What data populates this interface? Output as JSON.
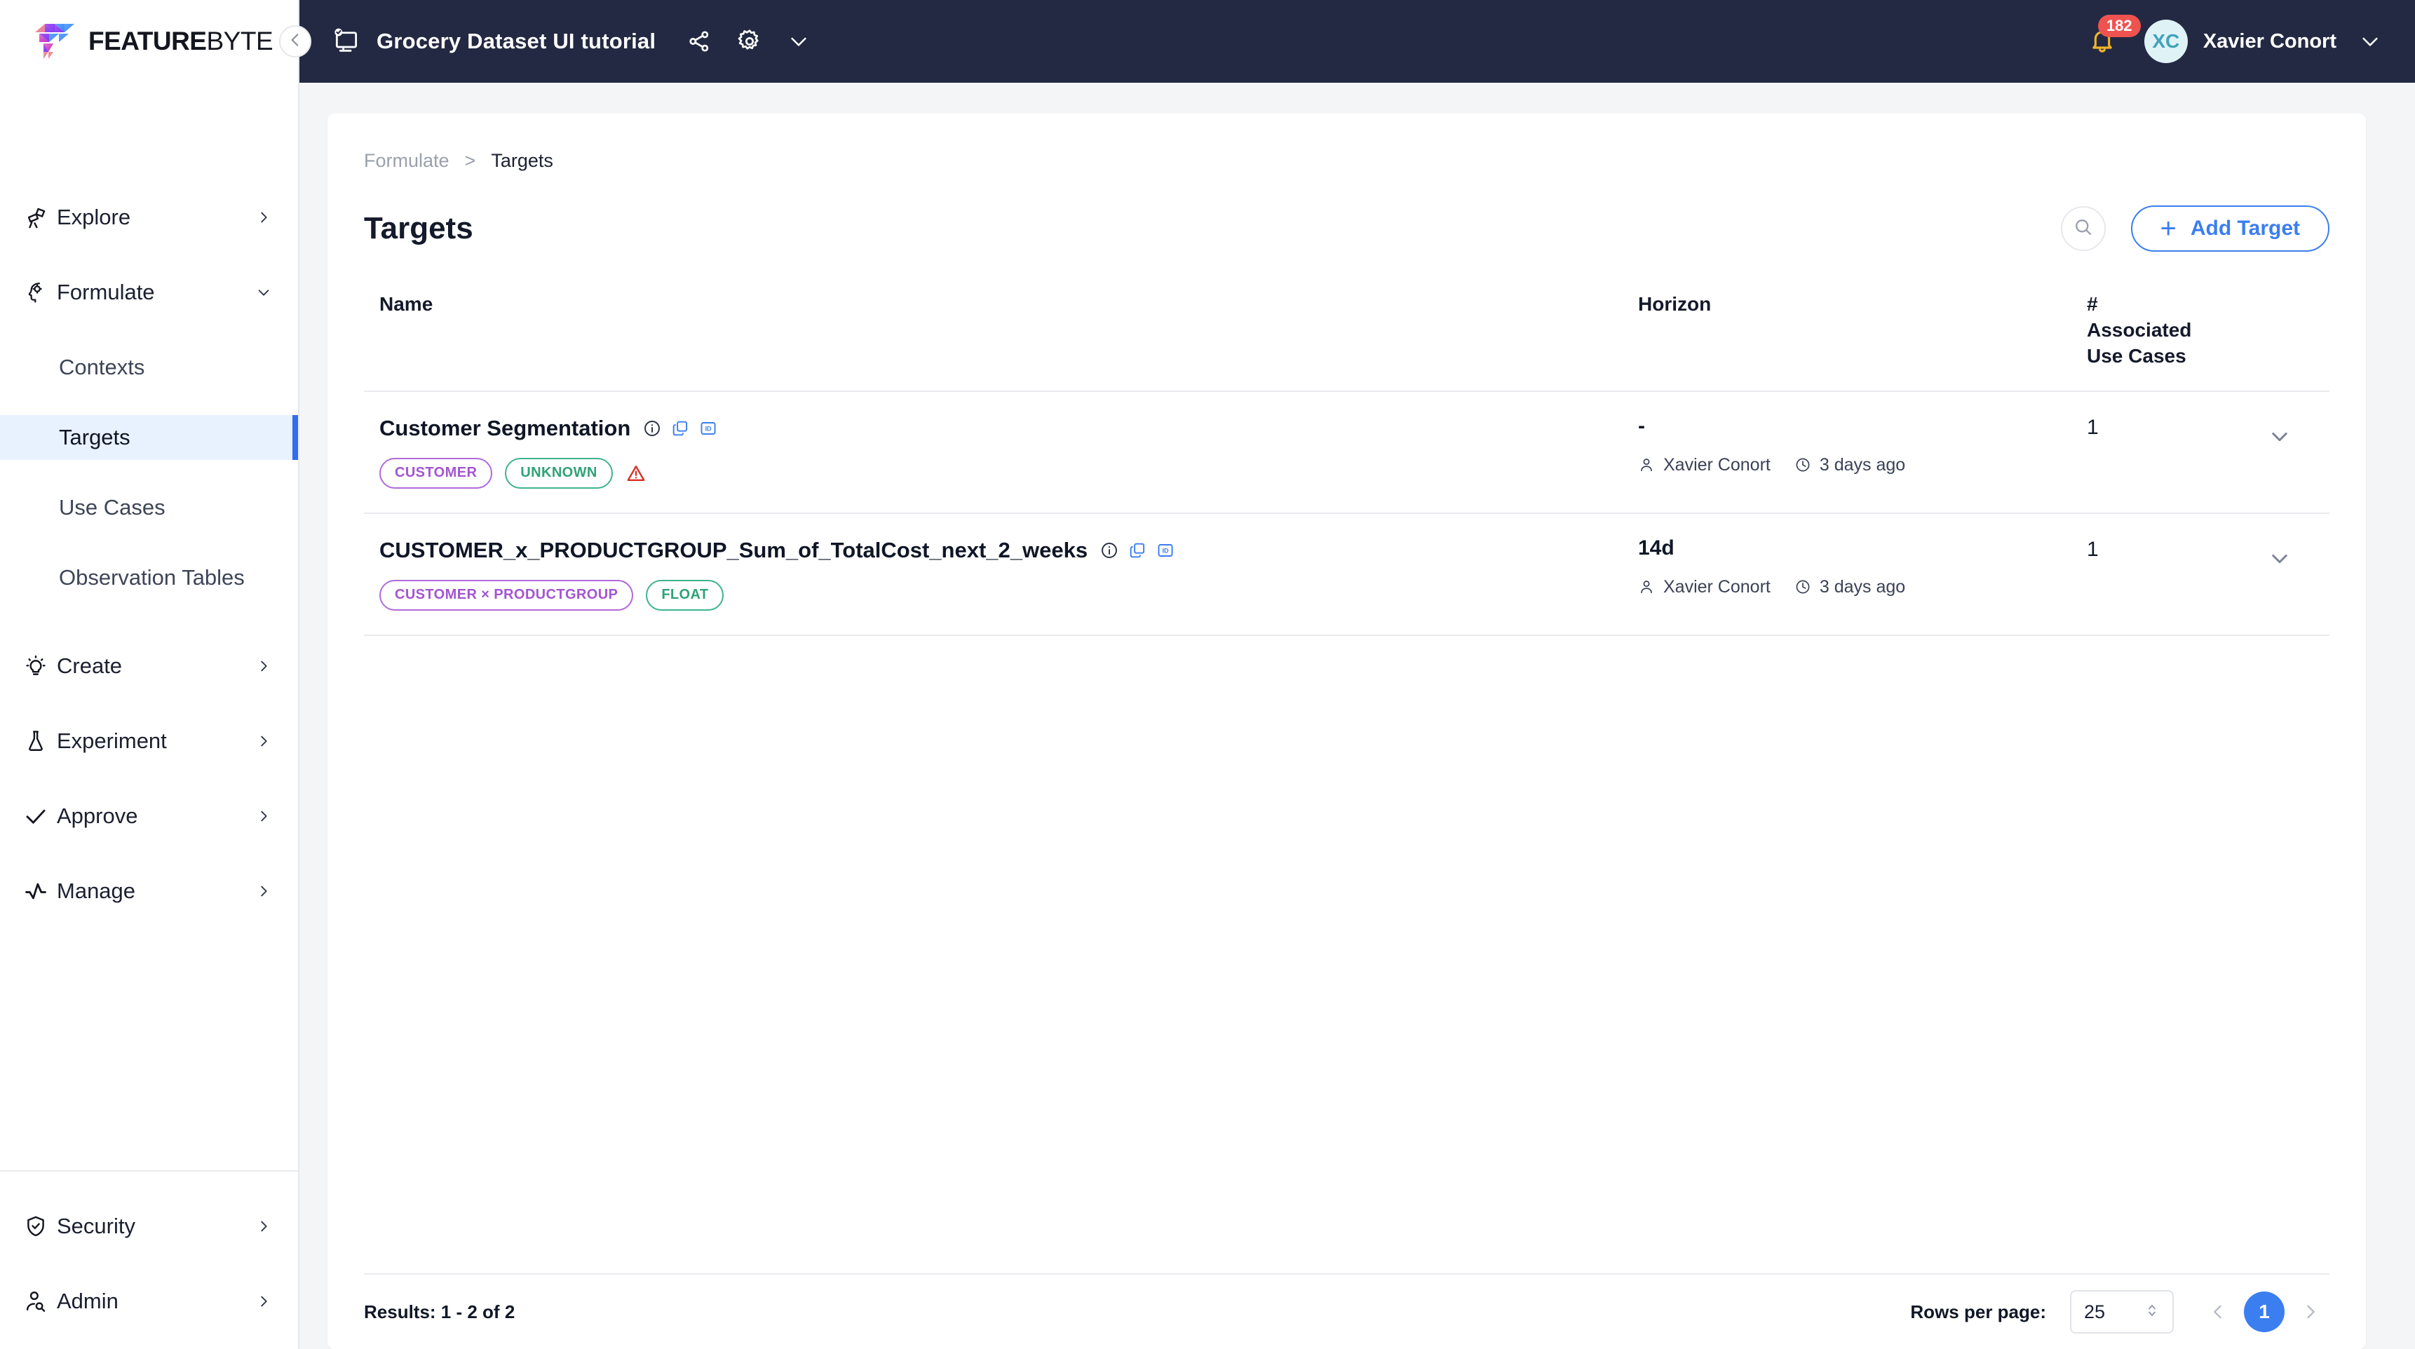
{
  "brand": {
    "name_bold": "FEATURE",
    "name_light": "BYTE"
  },
  "topbar": {
    "workspace_icon": "monitor-check-icon",
    "workspace_title": "Grocery Dataset UI tutorial",
    "share_icon": "share-icon",
    "settings_icon": "gear-icon",
    "more_icon": "chevron-down-icon",
    "notification_count": "182",
    "avatar_initials": "XC",
    "user_name": "Xavier Conort"
  },
  "sidebar": {
    "collapse_icon": "chevron-left-icon",
    "items": [
      {
        "label": "Explore",
        "icon": "telescope-icon",
        "chevron": "chevron-right-icon",
        "expanded": false
      },
      {
        "label": "Formulate",
        "icon": "head-gear-icon",
        "chevron": "chevron-down-icon",
        "expanded": true
      }
    ],
    "formulate_children": [
      {
        "label": "Contexts",
        "active": false
      },
      {
        "label": "Targets",
        "active": true
      },
      {
        "label": "Use Cases",
        "active": false
      },
      {
        "label": "Observation Tables",
        "active": false
      }
    ],
    "items_after": [
      {
        "label": "Create",
        "icon": "lightbulb-icon",
        "chevron": "chevron-right-icon"
      },
      {
        "label": "Experiment",
        "icon": "flask-icon",
        "chevron": "chevron-right-icon"
      },
      {
        "label": "Approve",
        "icon": "check-icon",
        "chevron": "chevron-right-icon"
      },
      {
        "label": "Manage",
        "icon": "activity-icon",
        "chevron": "chevron-right-icon"
      }
    ],
    "bottom_items": [
      {
        "label": "Security",
        "icon": "shield-check-icon",
        "chevron": "chevron-right-icon"
      },
      {
        "label": "Admin",
        "icon": "user-search-icon",
        "chevron": "chevron-right-icon"
      }
    ]
  },
  "breadcrumb": {
    "parent": "Formulate",
    "separator": ">",
    "current": "Targets"
  },
  "page": {
    "title": "Targets",
    "search_icon": "search-icon",
    "add_button_label": "Add Target",
    "add_button_plus": "+"
  },
  "table": {
    "headers": {
      "name": "Name",
      "horizon": "Horizon",
      "use_cases_line1": "#",
      "use_cases_line2": "Associated",
      "use_cases_line3": "Use Cases"
    },
    "rows": [
      {
        "name": "Customer Segmentation",
        "info_icon": "info-circle-icon",
        "copy_icon": "copy-icon",
        "id_icon": "id-badge-icon",
        "tags": [
          {
            "label": "CUSTOMER",
            "color": "purple"
          },
          {
            "label": "UNKNOWN",
            "color": "green"
          }
        ],
        "warning_icon": "warning-triangle-icon",
        "has_warning": true,
        "horizon": "-",
        "author_icon": "user-icon",
        "author": "Xavier Conort",
        "time_icon": "clock-icon",
        "updated": "3 days ago",
        "use_cases": "1",
        "expand_icon": "chevron-down-icon"
      },
      {
        "name": "CUSTOMER_x_PRODUCTGROUP_Sum_of_TotalCost_next_2_weeks",
        "info_icon": "info-circle-icon",
        "copy_icon": "copy-icon",
        "id_icon": "id-badge-icon",
        "tags": [
          {
            "label": "CUSTOMER × PRODUCTGROUP",
            "color": "purple"
          },
          {
            "label": "FLOAT",
            "color": "green"
          }
        ],
        "has_warning": false,
        "horizon": "14d",
        "author_icon": "user-icon",
        "author": "Xavier Conort",
        "time_icon": "clock-icon",
        "updated": "3 days ago",
        "use_cases": "1",
        "expand_icon": "chevron-down-icon"
      }
    ]
  },
  "footer": {
    "results": "Results: 1 - 2 of 2",
    "rows_per_page_label": "Rows per page:",
    "rows_per_page_value": "25",
    "stepper_icon": "chevron-updown-icon",
    "prev_icon": "chevron-left-icon",
    "next_icon": "chevron-right-icon",
    "current_page": "1"
  },
  "colors": {
    "topbar_bg": "#232942",
    "accent_blue": "#3b7ef0",
    "active_nav_bg": "#e8f2fe",
    "tag_purple": "#a355d1",
    "tag_green": "#2fa276",
    "badge_red": "#ef5350",
    "bell_yellow": "#f0b429",
    "avatar_bg": "#dff3f7",
    "avatar_fg": "#3fa3bb"
  }
}
